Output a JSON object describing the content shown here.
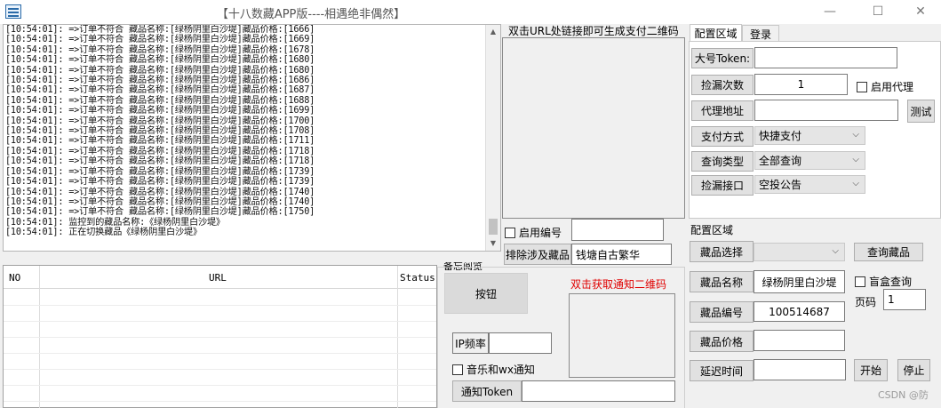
{
  "window": {
    "title": "【十八数藏APP版----相遇绝非偶然】",
    "minimize": "—",
    "maximize": "☐",
    "close": "✕"
  },
  "log": {
    "lines": [
      "[10:54:01]: =>订单不符合 藏品名称:[绿杨阴里白沙堤]藏品价格:[1666]",
      "[10:54:01]: =>订单不符合 藏品名称:[绿杨阴里白沙堤]藏品价格:[1669]",
      "[10:54:01]: =>订单不符合 藏品名称:[绿杨阴里白沙堤]藏品价格:[1678]",
      "[10:54:01]: =>订单不符合 藏品名称:[绿杨阴里白沙堤]藏品价格:[1680]",
      "[10:54:01]: =>订单不符合 藏品名称:[绿杨阴里白沙堤]藏品价格:[1680]",
      "[10:54:01]: =>订单不符合 藏品名称:[绿杨阴里白沙堤]藏品价格:[1686]",
      "[10:54:01]: =>订单不符合 藏品名称:[绿杨阴里白沙堤]藏品价格:[1687]",
      "[10:54:01]: =>订单不符合 藏品名称:[绿杨阴里白沙堤]藏品价格:[1688]",
      "[10:54:01]: =>订单不符合 藏品名称:[绿杨阴里白沙堤]藏品价格:[1699]",
      "[10:54:01]: =>订单不符合 藏品名称:[绿杨阴里白沙堤]藏品价格:[1700]",
      "[10:54:01]: =>订单不符合 藏品名称:[绿杨阴里白沙堤]藏品价格:[1708]",
      "[10:54:01]: =>订单不符合 藏品名称:[绿杨阴里白沙堤]藏品价格:[1711]",
      "[10:54:01]: =>订单不符合 藏品名称:[绿杨阴里白沙堤]藏品价格:[1718]",
      "[10:54:01]: =>订单不符合 藏品名称:[绿杨阴里白沙堤]藏品价格:[1718]",
      "[10:54:01]: =>订单不符合 藏品名称:[绿杨阴里白沙堤]藏品价格:[1739]",
      "[10:54:01]: =>订单不符合 藏品名称:[绿杨阴里白沙堤]藏品价格:[1739]",
      "[10:54:01]: =>订单不符合 藏品名称:[绿杨阴里白沙堤]藏品价格:[1740]",
      "[10:54:01]: =>订单不符合 藏品名称:[绿杨阴里白沙堤]藏品价格:[1740]",
      "[10:54:01]: =>订单不符合 藏品名称:[绿杨阴里白沙堤]藏品价格:[1750]",
      "[10:54:01]: 监控到的藏品名称:《绿杨阴里白沙堤》",
      "[10:54:01]: 正在切换藏品《绿杨阴里白沙堤》"
    ]
  },
  "grid": {
    "columns": [
      "NO",
      "URL",
      "Status"
    ]
  },
  "qr_panel": {
    "title": "双击URL处链接即可生成支付二维码",
    "enable_number_label": "启用编号",
    "enable_number_value": "",
    "exclude_button": "排除涉及藏品",
    "exclude_value": "钱塘自古繁华"
  },
  "notify": {
    "group_label": "备忘阅览",
    "button_label": "按钮",
    "qr_label": "双击获取通知二维码",
    "ip_freq_label": "IP频率",
    "ip_freq_value": "",
    "music_wx_label": "音乐和wx通知",
    "token_button": "通知Token",
    "token_value": ""
  },
  "config": {
    "tabs": [
      "配置区域",
      "登录"
    ],
    "token_button": "大号Token:",
    "token_value": "",
    "leak_count_button": "捡漏次数",
    "leak_count_value": "1",
    "enable_proxy_label": "启用代理",
    "proxy_addr_button": "代理地址",
    "proxy_addr_value": "",
    "test_button": "测试",
    "pay_method_button": "支付方式",
    "pay_method_value": "快捷支付",
    "query_type_button": "查询类型",
    "query_type_value": "全部查询",
    "leak_api_button": "捡漏接口",
    "leak_api_value": "空投公告"
  },
  "config2": {
    "group_label": "配置区域",
    "select_button": "藏品选择",
    "select_value": "",
    "query_button": "查询藏品",
    "name_button": "藏品名称",
    "name_value": "绿杨阴里白沙堤",
    "blind_box_label": "盲盒查询",
    "page_label": "页码",
    "page_value": "1",
    "number_button": "藏品编号",
    "number_value": "100514687",
    "price_button": "藏品价格",
    "price_value": "",
    "delay_button": "延迟时间",
    "delay_value": "",
    "start_button": "开始",
    "stop_button": "停止"
  },
  "watermark": "CSDN @防",
  "colors": {
    "notify_qr_label": "#e00000",
    "icon_blue": "#2a6aa8"
  },
  "icons": {
    "app": "app-logo-icon",
    "dropdown": "chevron-down-icon"
  }
}
